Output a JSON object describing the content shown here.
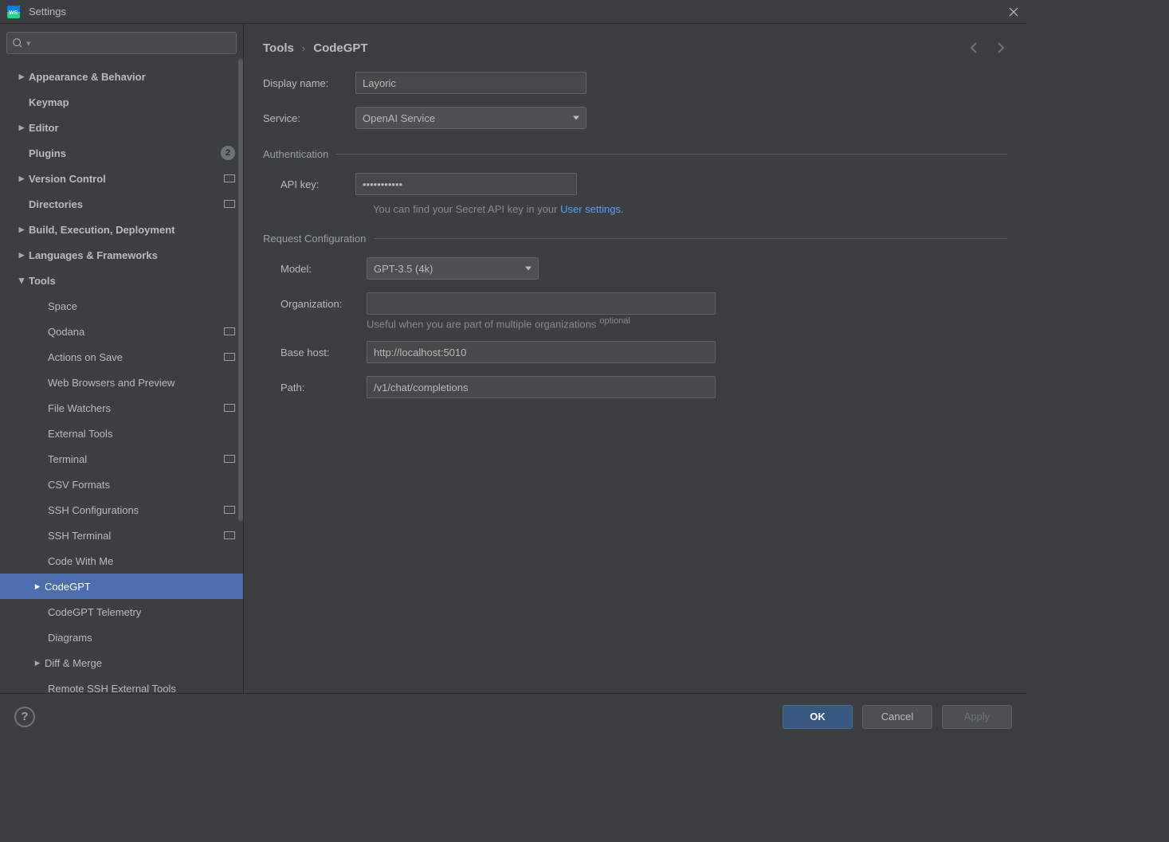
{
  "title": "Settings",
  "breadcrumb": {
    "root": "Tools",
    "leaf": "CodeGPT"
  },
  "sidebar": {
    "items": [
      {
        "label": "Appearance & Behavior",
        "bold": true,
        "chev": "right",
        "level": 0
      },
      {
        "label": "Keymap",
        "bold": true,
        "level": 0,
        "noarrow": true
      },
      {
        "label": "Editor",
        "bold": true,
        "chev": "right",
        "level": 0
      },
      {
        "label": "Plugins",
        "bold": true,
        "level": 0,
        "noarrow": true,
        "badge": "2"
      },
      {
        "label": "Version Control",
        "bold": true,
        "chev": "right",
        "level": 0,
        "proj": true
      },
      {
        "label": "Directories",
        "bold": true,
        "level": 0,
        "noarrow": true,
        "proj": true
      },
      {
        "label": "Build, Execution, Deployment",
        "bold": true,
        "chev": "right",
        "level": 0
      },
      {
        "label": "Languages & Frameworks",
        "bold": true,
        "chev": "right",
        "level": 0
      },
      {
        "label": "Tools",
        "bold": true,
        "chev": "down",
        "level": 0
      },
      {
        "label": "Space",
        "level": 1
      },
      {
        "label": "Qodana",
        "level": 1,
        "proj": true
      },
      {
        "label": "Actions on Save",
        "level": 1,
        "proj": true
      },
      {
        "label": "Web Browsers and Preview",
        "level": 1
      },
      {
        "label": "File Watchers",
        "level": 1,
        "proj": true
      },
      {
        "label": "External Tools",
        "level": 1
      },
      {
        "label": "Terminal",
        "level": 1,
        "proj": true
      },
      {
        "label": "CSV Formats",
        "level": 1
      },
      {
        "label": "SSH Configurations",
        "level": 1,
        "proj": true
      },
      {
        "label": "SSH Terminal",
        "level": 1,
        "proj": true
      },
      {
        "label": "Code With Me",
        "level": 1
      },
      {
        "label": "CodeGPT",
        "level": 1,
        "chev": "right",
        "selected": true
      },
      {
        "label": "CodeGPT Telemetry",
        "level": 1
      },
      {
        "label": "Diagrams",
        "level": 1
      },
      {
        "label": "Diff & Merge",
        "level": 1,
        "chev": "right"
      },
      {
        "label": "Remote SSH External Tools",
        "level": 1
      }
    ]
  },
  "labels": {
    "display_name": "Display name:",
    "service": "Service:",
    "auth_section": "Authentication",
    "api_key": "API key:",
    "api_hint_pre": "You can find your Secret API key in your ",
    "api_hint_link": "User settings",
    "req_section": "Request Configuration",
    "model": "Model:",
    "organization": "Organization:",
    "org_hint": "Useful when you are part of multiple organizations",
    "optional": "optional",
    "base_host": "Base host:",
    "path": "Path:"
  },
  "values": {
    "display_name": "Layoric",
    "service": "OpenAI Service",
    "api_key": "●●●●●●●●●●●",
    "model": "GPT-3.5 (4k)",
    "organization": "",
    "base_host": "http://localhost:5010",
    "path": "/v1/chat/completions"
  },
  "footer": {
    "ok": "OK",
    "cancel": "Cancel",
    "apply": "Apply"
  }
}
